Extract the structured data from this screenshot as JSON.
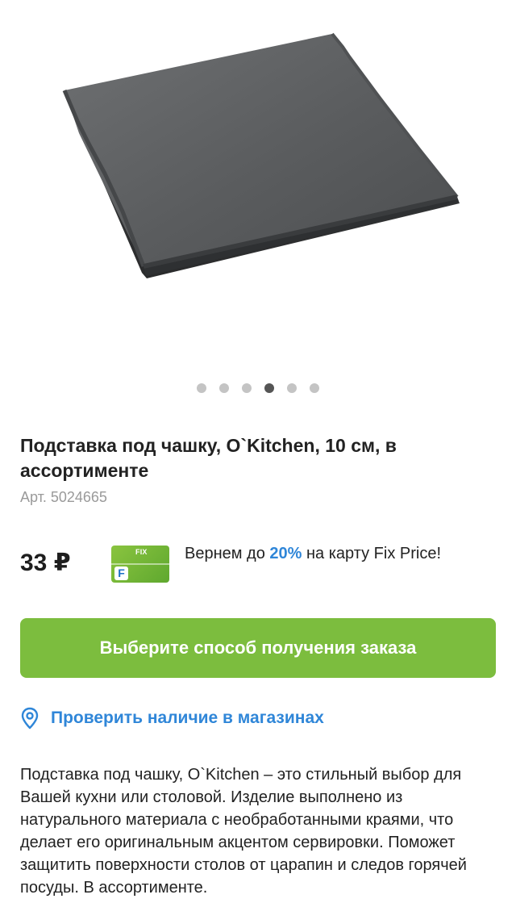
{
  "gallery": {
    "image_alt": "slate-coaster-photo",
    "dots_count": 6,
    "active_dot_index": 3
  },
  "product": {
    "title": "Подставка под чашку, O`Kitchen, 10 см, в ассортименте",
    "article": "Арт. 5024665",
    "price": "33 ₽"
  },
  "loyalty_card": {
    "brand": "FIX",
    "letter": "F"
  },
  "cashback": {
    "prefix": "Вернем до ",
    "percent": "20%",
    "suffix": " на карту Fix Price!"
  },
  "order_button": {
    "label": "Выберите способ получения заказа"
  },
  "stores_link": {
    "icon": "location-pin-icon",
    "label": "Проверить наличие в магазинах"
  },
  "description": {
    "text": "Подставка под чашку, O`Kitchen – это стильный выбор для Вашей кухни или столовой. Изделие выполнено из натурального материала с необработанными краями, что делает его оригинальным акцентом сервировки. Поможет защитить поверхности столов от царапин и следов горячей посуды. В ассортименте."
  },
  "colors": {
    "accent_green": "#7cbd3e",
    "link_blue": "#2f86d8"
  }
}
